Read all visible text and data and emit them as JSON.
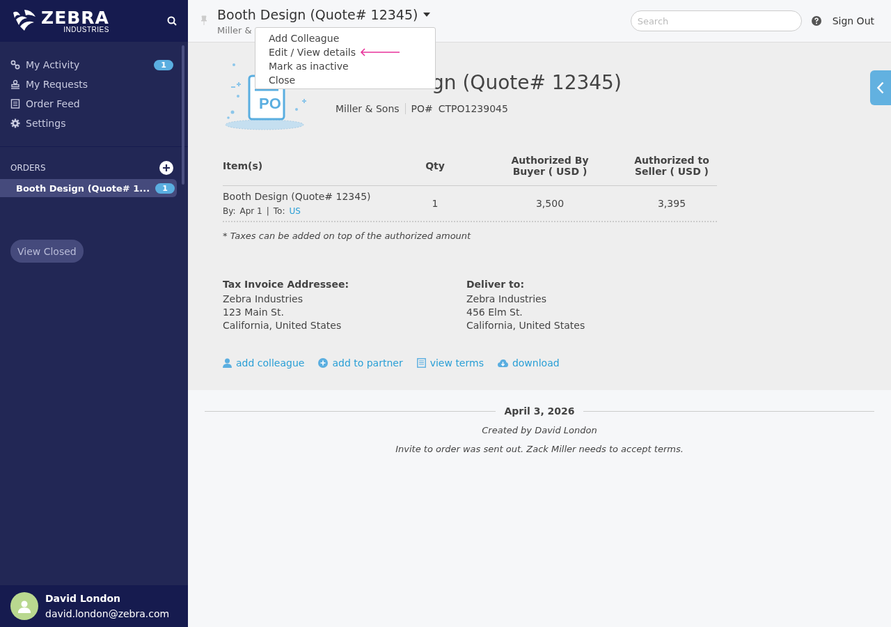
{
  "logo": {
    "name": "ZEBRA",
    "sub": "INDUSTRIES"
  },
  "nav": [
    {
      "label": "My Activity",
      "badge": "1"
    },
    {
      "label": "My Requests"
    },
    {
      "label": "Order Feed"
    },
    {
      "label": "Settings"
    }
  ],
  "orders": {
    "heading": "ORDERS",
    "items": [
      {
        "label": "Booth Design (Quote# 1...",
        "badge": "1",
        "selected": true
      }
    ],
    "view_closed": "View Closed"
  },
  "user": {
    "name": "David London",
    "email": "david.london@zebra.com"
  },
  "header": {
    "title": "Booth Design (Quote# 12345)",
    "subtitle": "Miller &",
    "search": {
      "placeholder": "Search"
    },
    "sign_out": "Sign Out"
  },
  "menu": {
    "items": [
      {
        "label": "Add Colleague",
        "pointed": false
      },
      {
        "label": "Edit / View details",
        "pointed": true
      },
      {
        "label": "Mark as inactive",
        "pointed": false
      },
      {
        "label": "Close",
        "pointed": false
      }
    ]
  },
  "order": {
    "title": "gn (Quote# 12345)",
    "company": "Miller & Sons",
    "po_label": "PO#",
    "po": "CTPO1239045",
    "badge_text": "PO"
  },
  "table": {
    "columns": [
      "Item(s)",
      "Qty",
      "Authorized By Buyer ( USD )",
      "Authorized to Seller ( USD )"
    ],
    "rows": [
      {
        "item": "Booth Design (Quote# 12345)",
        "by_label": "By:",
        "by": "Apr 1",
        "separator": "|",
        "to_label": "To:",
        "to": "US",
        "qty": "1",
        "buyer": "3,500",
        "seller": "3,395"
      }
    ],
    "note": "* Taxes can be added on top of the authorized amount"
  },
  "addresses": [
    {
      "heading": "Tax Invoice Addressee:",
      "lines": [
        "Zebra Industries",
        "123 Main St.",
        "California, United States"
      ]
    },
    {
      "heading": "Deliver to:",
      "lines": [
        "Zebra Industries",
        "456 Elm St.",
        "California, United States"
      ]
    }
  ],
  "actions": [
    {
      "label": "add colleague"
    },
    {
      "label": "add to partner"
    },
    {
      "label": "view terms"
    },
    {
      "label": "download"
    }
  ],
  "timeline": {
    "date": "April 3, 2026",
    "entries": [
      "Created by David London",
      "Invite to order was sent out. Zack Miller needs to accept terms."
    ]
  }
}
